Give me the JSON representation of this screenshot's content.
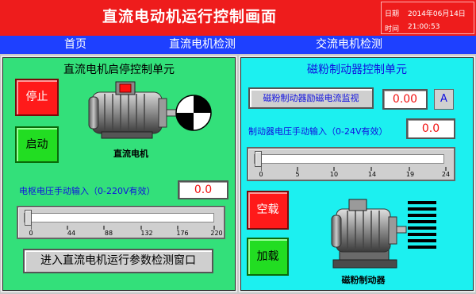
{
  "header": {
    "title": "直流电动机运行控制画面",
    "date_label": "日期",
    "date_value": "2014年06月14日",
    "time_label": "时间",
    "time_value": "21:00:53"
  },
  "nav": {
    "items": [
      {
        "label": "首页"
      },
      {
        "label": "直流电机检测"
      },
      {
        "label": "交流电机检测"
      }
    ]
  },
  "left_panel": {
    "title": "直流电机启停控制单元",
    "stop_label": "停止",
    "start_label": "启动",
    "motor_caption": "直流电机",
    "voltage_input_label": "电枢电压手动输入（0-220V有效）",
    "voltage_value": "0.0",
    "slider": {
      "value": 0,
      "min": 0,
      "max": 220,
      "ticks": [
        "0",
        "44",
        "88",
        "132",
        "176",
        "220"
      ]
    },
    "enter_button_label": "进入直流电机运行参数检测窗口"
  },
  "right_panel": {
    "title": "磁粉制动器控制单元",
    "monitor_button_label": "磁粉制动器励磁电流监视",
    "current_value": "0.00",
    "current_unit": "A",
    "voltage_input_label": "制动器电压手动输入（0-24V有效）",
    "voltage_value": "0.0",
    "slider": {
      "value": 0,
      "min": 0,
      "max": 24,
      "ticks": [
        "0",
        "5",
        "10",
        "14",
        "19",
        "24"
      ]
    },
    "no_load_label": "空载",
    "load_label": "加载",
    "brake_caption": "磁粉制动器"
  },
  "colors": {
    "header_bg": "#ee1c1c",
    "nav_bg": "#1e40ff",
    "left_panel_bg": "#33e07a",
    "right_panel_bg": "#1cf0f0",
    "value_text": "#f01010",
    "label_text": "#1010e0"
  },
  "icons": {
    "motor": "dc-motor-icon",
    "encoder": "encoder-disc-icon",
    "brake": "magnetic-powder-brake-icon",
    "coil": "coil-stripes-icon"
  }
}
